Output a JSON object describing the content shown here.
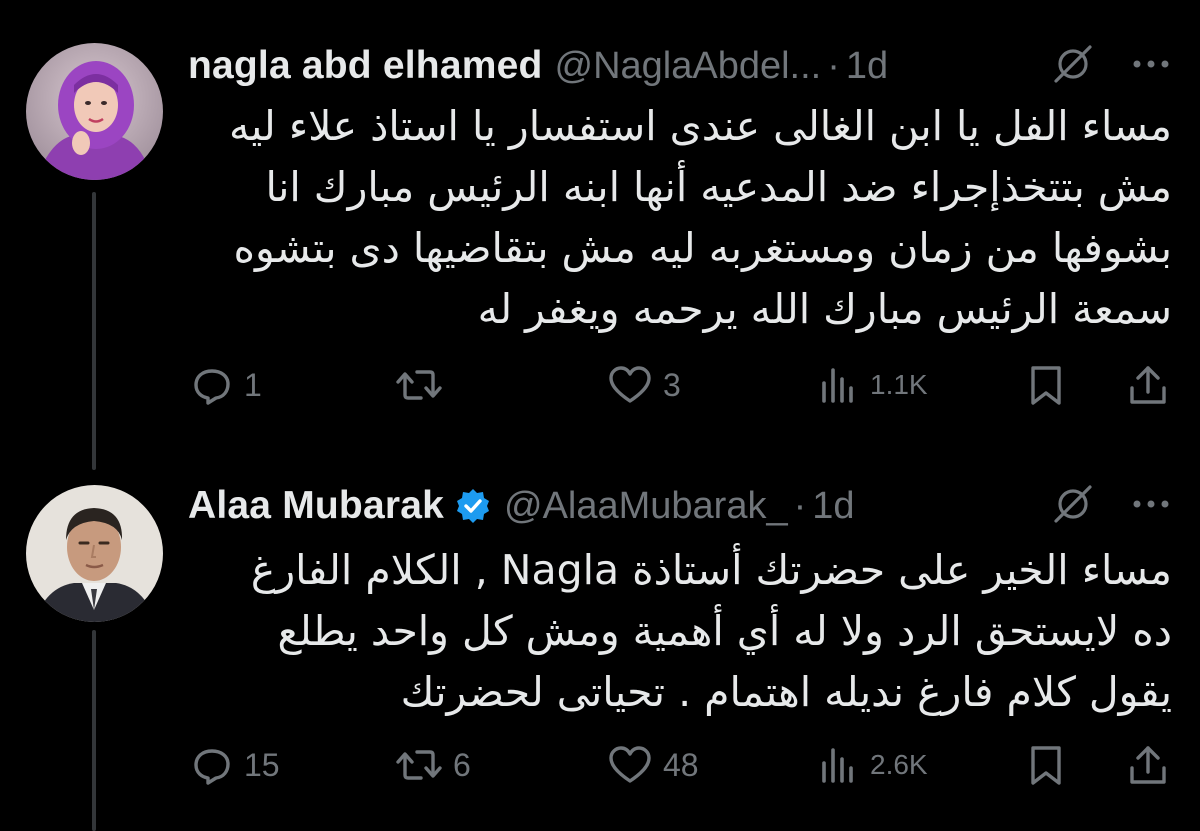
{
  "tweets": [
    {
      "name": "nagla abd elhamed",
      "handle": "@NaglaAbdel...",
      "separator": "·",
      "time": "1d",
      "verified": false,
      "text_lines": [
        "مساء الفل يا ابن الغالى عندى استفسار يا استاذ علاء ليه",
        "مش بتتخذإجراء ضد المدعيه أنها ابنه الرئيس مبارك انا",
        "بشوفها من زمان ومستغربه ليه مش بتقاضيها دى بتشوه",
        "سمعة الرئيس مبارك الله يرحمه ويغفر له"
      ],
      "replies": "1",
      "retweets": "",
      "likes": "3",
      "views": "1.1K"
    },
    {
      "name": "Alaa Mubarak",
      "handle": "@AlaaMubarak_",
      "separator": "·",
      "time": "1d",
      "verified": true,
      "text_lines": [
        "مساء الخير على حضرتك أستاذة Nagla , الكلام الفارغ",
        "ده لايستحق الرد ولا له أي أهمية ومش كل واحد يطلع",
        "يقول كلام فارغ نديله اهتمام . تحياتى لحضرتك"
      ],
      "replies": "15",
      "retweets": "6",
      "likes": "48",
      "views": "2.6K"
    }
  ],
  "icons": {
    "reply": "reply-icon",
    "retweet": "retweet-icon",
    "like": "heart-icon",
    "views": "views-icon",
    "bookmark": "bookmark-icon",
    "share": "share-icon",
    "grok": "grok-icon",
    "more": "more-icon",
    "verified": "verified-badge-icon"
  },
  "colors": {
    "background": "#000000",
    "text": "#e7e9ea",
    "muted": "#71767b",
    "verified": "#1d9bf0",
    "thread_line": "#333639"
  }
}
